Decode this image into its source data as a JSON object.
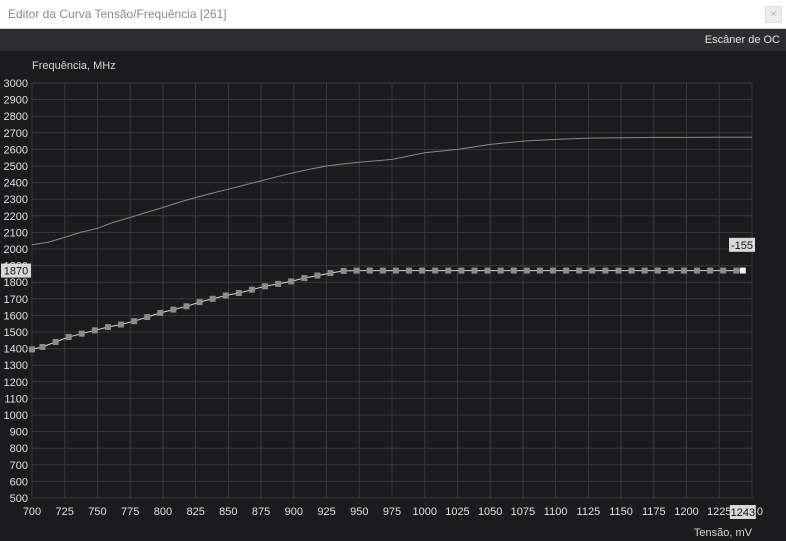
{
  "window": {
    "title": "Editor da Curva Tensão/Frequência [261]",
    "close_glyph": "×"
  },
  "toolbar": {
    "scanner_label": "Escâner de OC"
  },
  "chart_data": {
    "type": "line",
    "xlabel": "Tensão, mV",
    "ylabel": "Frequência, MHz",
    "xlim": [
      700,
      1250
    ],
    "ylim": [
      500,
      3000
    ],
    "x_ticks": [
      700,
      725,
      750,
      775,
      800,
      825,
      850,
      875,
      900,
      925,
      950,
      975,
      1000,
      1025,
      1050,
      1075,
      1100,
      1125,
      1150,
      1175,
      1200,
      1225
    ],
    "y_ticks": [
      500,
      600,
      700,
      800,
      900,
      1000,
      1100,
      1200,
      1300,
      1400,
      1500,
      1600,
      1700,
      1800,
      1900,
      2000,
      2100,
      2200,
      2300,
      2400,
      2500,
      2600,
      2700,
      2800,
      2900,
      3000
    ],
    "grid": true,
    "current_frequency_label": "1870",
    "current_voltage_label": "1243",
    "end_tick_label": "0",
    "offset_label": "-155",
    "series": [
      {
        "x": [
          700,
          712,
          725,
          737,
          750,
          762,
          775,
          787,
          800,
          812,
          825,
          837,
          850,
          862,
          875,
          887,
          900,
          912,
          925,
          937,
          950
        ],
        "y": [
          2025,
          2040,
          2070,
          2100,
          2125,
          2160,
          2190,
          2220,
          2250,
          2280,
          2310,
          2335,
          2360,
          2385,
          2410,
          2435,
          2460,
          2480,
          2500,
          2512,
          2522
        ]
      },
      {
        "x": [
          950,
          975,
          1000,
          1025,
          1050,
          1075,
          1100,
          1125,
          1150,
          1175,
          1200,
          1225,
          1250
        ],
        "y": [
          2522,
          2540,
          2580,
          2600,
          2630,
          2650,
          2660,
          2668,
          2670,
          2672,
          2672,
          2673,
          2673
        ]
      },
      {
        "x": [
          700,
          708,
          718,
          728,
          738,
          748,
          758,
          768,
          778,
          788,
          798,
          808,
          818,
          828,
          838,
          848,
          858,
          868,
          878,
          888,
          898,
          908,
          918,
          928,
          938,
          948,
          958,
          968,
          978,
          988,
          998,
          1008,
          1018,
          1028,
          1038,
          1048,
          1058,
          1068,
          1078,
          1088,
          1098,
          1108,
          1118,
          1128,
          1138,
          1148,
          1158,
          1168,
          1178,
          1188,
          1198,
          1208,
          1218,
          1228,
          1238,
          1243
        ],
        "y": [
          1395,
          1410,
          1440,
          1470,
          1490,
          1510,
          1530,
          1545,
          1565,
          1590,
          1615,
          1635,
          1655,
          1680,
          1700,
          1720,
          1735,
          1755,
          1775,
          1790,
          1805,
          1825,
          1840,
          1855,
          1868,
          1870,
          1870,
          1870,
          1870,
          1870,
          1870,
          1870,
          1870,
          1870,
          1870,
          1870,
          1870,
          1870,
          1870,
          1870,
          1870,
          1870,
          1870,
          1870,
          1870,
          1870,
          1870,
          1870,
          1870,
          1870,
          1870,
          1870,
          1870,
          1870,
          1870,
          1870
        ]
      }
    ]
  }
}
